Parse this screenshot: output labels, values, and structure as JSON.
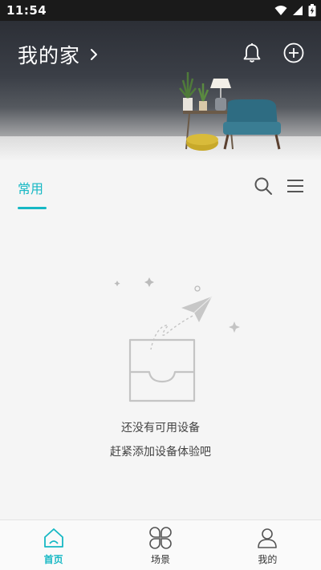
{
  "status_bar": {
    "time": "11:54",
    "icons": [
      "wifi-icon",
      "signal-icon",
      "battery-charging-icon"
    ]
  },
  "header": {
    "title": "我的家",
    "title_icon": "chevron-right-icon",
    "actions": [
      "bell-icon",
      "add-circle-icon"
    ]
  },
  "tabs": {
    "active_label": "常用",
    "search_icon": "search-icon",
    "menu_icon": "menu-icon"
  },
  "empty_state": {
    "line1": "还没有可用设备",
    "line2": "赶紧添加设备体验吧"
  },
  "bottom_nav": {
    "items": [
      {
        "label": "首页",
        "icon": "home-icon",
        "active": true
      },
      {
        "label": "场景",
        "icon": "scene-icon",
        "active": false
      },
      {
        "label": "我的",
        "icon": "profile-icon",
        "active": false
      }
    ]
  },
  "colors": {
    "accent": "#16b8c4",
    "status_bar": "#1a1a1a",
    "background": "#f5f5f5"
  }
}
